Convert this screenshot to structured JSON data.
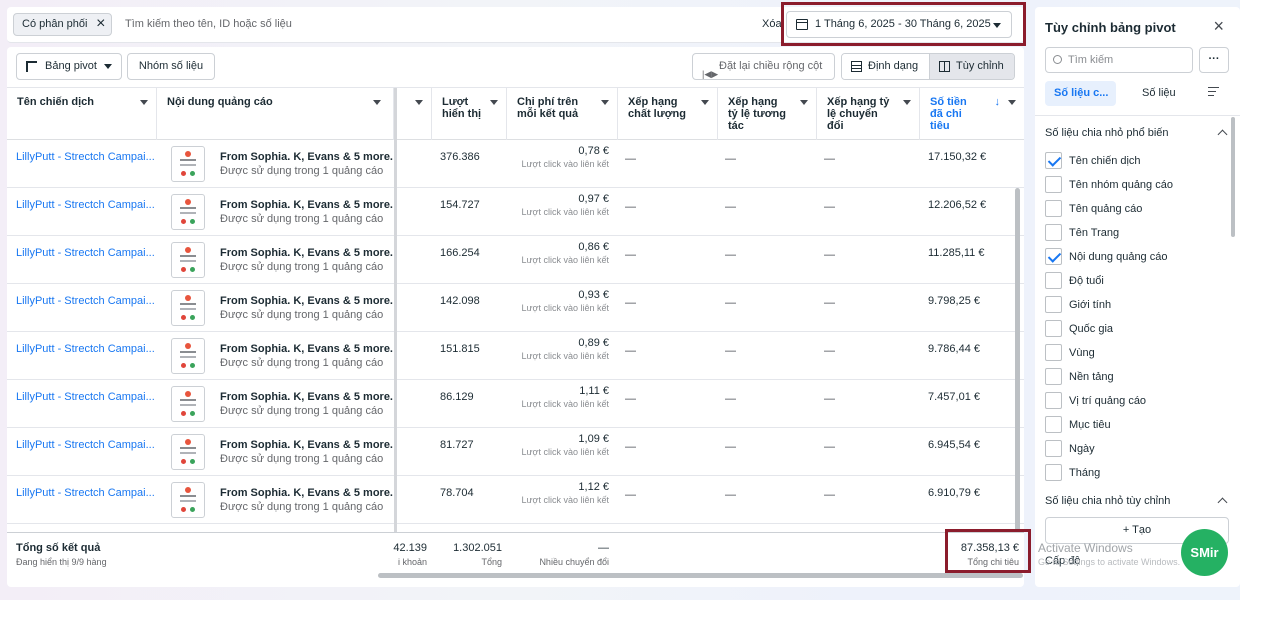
{
  "topbar": {
    "filter_chip": "Có phân phối",
    "search_placeholder": "Tìm kiếm theo tên, ID hoặc số liệu",
    "clear_label": "Xóa",
    "date_range": "1 Tháng 6, 2025 - 30 Tháng 6, 2025"
  },
  "toolbar": {
    "pivot_label": "Bảng pivot",
    "group_label": "Nhóm số liệu",
    "reset_width_label": "Đặt lại chiều rộng cột",
    "format_label": "Định dạng",
    "customize_label": "Tùy chỉnh"
  },
  "table": {
    "headers": {
      "campaign": "Tên chiến dịch",
      "ad_content": "Nội dung quảng cáo",
      "impressions": "Lượt hiển thị",
      "cost_per_result": "Chi phí trên mỗi kết quả",
      "quality_rank": "Xếp hạng chất lượng",
      "engagement_rank": "Xếp hạng tỷ lệ tương tác",
      "conversion_rank": "Xếp hạng tỷ lệ chuyển đổi",
      "amount_spent": "Số tiền đã chi tiêu"
    },
    "rows": [
      {
        "campaign": "LillyPutt - Strectch Campai...",
        "ad_title": "From Sophia. K, Evans & 5 more.",
        "ad_sub": "Được sử dụng trong 1 quảng cáo",
        "impressions": "376.386",
        "cpr": "0,78 €",
        "cpr_sub": "Lượt click vào liên kết",
        "q": "—",
        "e": "—",
        "c": "—",
        "spend": "17.150,32 €"
      },
      {
        "campaign": "LillyPutt - Strectch Campai...",
        "ad_title": "From Sophia. K, Evans & 5 more.",
        "ad_sub": "Được sử dụng trong 1 quảng cáo",
        "impressions": "154.727",
        "cpr": "0,97 €",
        "cpr_sub": "Lượt click vào liên kết",
        "q": "—",
        "e": "—",
        "c": "—",
        "spend": "12.206,52 €"
      },
      {
        "campaign": "LillyPutt - Strectch Campai...",
        "ad_title": "From Sophia. K, Evans & 5 more.",
        "ad_sub": "Được sử dụng trong 1 quảng cáo",
        "impressions": "166.254",
        "cpr": "0,86 €",
        "cpr_sub": "Lượt click vào liên kết",
        "q": "—",
        "e": "—",
        "c": "—",
        "spend": "11.285,11 €"
      },
      {
        "campaign": "LillyPutt - Strectch Campai...",
        "ad_title": "From Sophia. K, Evans & 5 more.",
        "ad_sub": "Được sử dụng trong 1 quảng cáo",
        "impressions": "142.098",
        "cpr": "0,93 €",
        "cpr_sub": "Lượt click vào liên kết",
        "q": "—",
        "e": "—",
        "c": "—",
        "spend": "9.798,25 €"
      },
      {
        "campaign": "LillyPutt - Strectch Campai...",
        "ad_title": "From Sophia. K, Evans & 5 more.",
        "ad_sub": "Được sử dụng trong 1 quảng cáo",
        "impressions": "151.815",
        "cpr": "0,89 €",
        "cpr_sub": "Lượt click vào liên kết",
        "q": "—",
        "e": "—",
        "c": "—",
        "spend": "9.786,44 €"
      },
      {
        "campaign": "LillyPutt - Strectch Campai...",
        "ad_title": "From Sophia. K, Evans & 5 more.",
        "ad_sub": "Được sử dụng trong 1 quảng cáo",
        "impressions": "86.129",
        "cpr": "1,11 €",
        "cpr_sub": "Lượt click vào liên kết",
        "q": "—",
        "e": "—",
        "c": "—",
        "spend": "7.457,01 €"
      },
      {
        "campaign": "LillyPutt - Strectch Campai...",
        "ad_title": "From Sophia. K, Evans & 5 more.",
        "ad_sub": "Được sử dụng trong 1 quảng cáo",
        "impressions": "81.727",
        "cpr": "1,09 €",
        "cpr_sub": "Lượt click vào liên kết",
        "q": "—",
        "e": "—",
        "c": "—",
        "spend": "6.945,54 €"
      },
      {
        "campaign": "LillyPutt - Strectch Campai...",
        "ad_title": "From Sophia. K, Evans & 5 more.",
        "ad_sub": "Được sử dụng trong 1 quảng cáo",
        "impressions": "78.704",
        "cpr": "1,12 €",
        "cpr_sub": "Lượt click vào liên kết",
        "q": "—",
        "e": "—",
        "c": "—",
        "spend": "6.910,79 €"
      }
    ],
    "footer": {
      "title": "Tổng số kết quả",
      "subtitle": "Đang hiển thị 9/9 hàng",
      "reach_value": "42.139",
      "reach_caption": "i khoản",
      "impressions_value": "1.302.051",
      "impressions_caption": "Tổng",
      "cpr_value": "—",
      "cpr_caption": "Nhiều chuyển đổi",
      "spend_value": "87.358,13 €",
      "spend_caption": "Tổng chi tiêu"
    }
  },
  "sidebar": {
    "title": "Tùy chỉnh bảng pivot",
    "search_placeholder": "Tìm kiếm",
    "more_label": "···",
    "tab_active": "Số liệu c...",
    "tab_metrics": "Số liệu",
    "common_section": "Số liệu chia nhỏ phổ biến",
    "items": [
      {
        "label": "Tên chiến dịch",
        "checked": true
      },
      {
        "label": "Tên nhóm quảng cáo",
        "checked": false
      },
      {
        "label": "Tên quảng cáo",
        "checked": false
      },
      {
        "label": "Tên Trang",
        "checked": false
      },
      {
        "label": "Nội dung quảng cáo",
        "checked": true
      },
      {
        "label": "Độ tuổi",
        "checked": false
      },
      {
        "label": "Giới tính",
        "checked": false
      },
      {
        "label": "Quốc gia",
        "checked": false
      },
      {
        "label": "Vùng",
        "checked": false
      },
      {
        "label": "Nền tảng",
        "checked": false
      },
      {
        "label": "Vị trí quảng cáo",
        "checked": false
      },
      {
        "label": "Mục tiêu",
        "checked": false
      },
      {
        "label": "Ngày",
        "checked": false
      },
      {
        "label": "Tháng",
        "checked": false
      }
    ],
    "custom_section": "Số liệu chia nhỏ tùy chỉnh",
    "create_label": "+ Tạo",
    "level_label": "Cấp độ"
  },
  "overlay": {
    "watermark_title": "Activate Windows",
    "watermark_sub": "Go to Settings to activate Windows.",
    "smir_label": "SMir"
  }
}
